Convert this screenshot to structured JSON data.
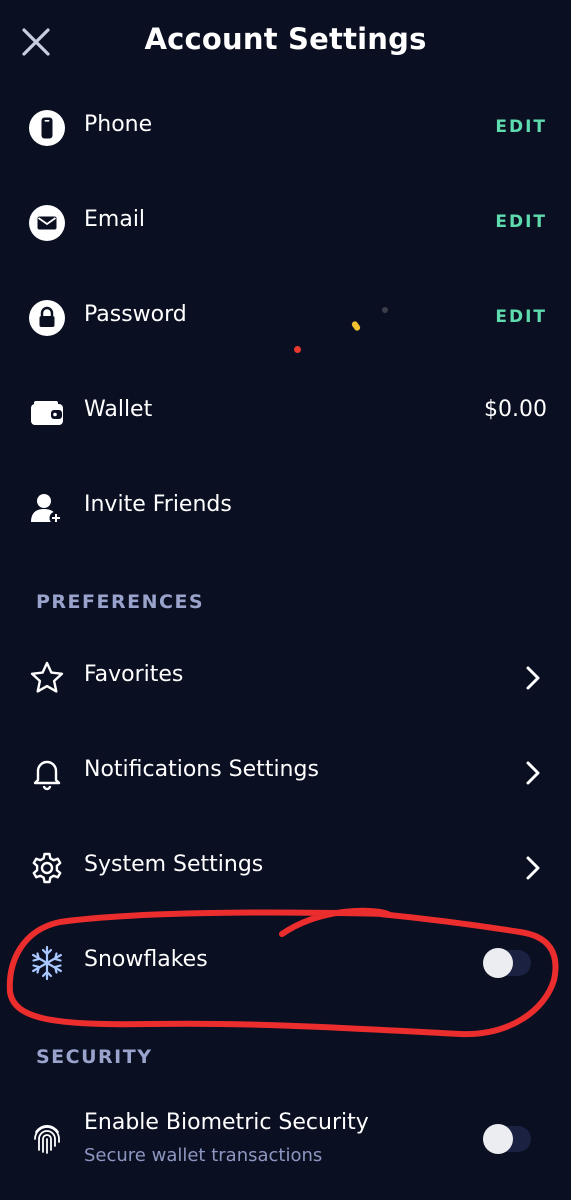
{
  "header": {
    "title": "Account Settings",
    "close_icon": "close-icon"
  },
  "account": {
    "phone": {
      "label": "Phone",
      "action": "EDIT",
      "icon": "phone-icon"
    },
    "email": {
      "label": "Email",
      "action": "EDIT",
      "icon": "envelope-icon"
    },
    "password": {
      "label": "Password",
      "action": "EDIT",
      "icon": "lock-icon"
    },
    "wallet": {
      "label": "Wallet",
      "value": "$0.00",
      "icon": "wallet-icon"
    },
    "invite": {
      "label": "Invite Friends",
      "icon": "add-user-icon"
    }
  },
  "preferences": {
    "header": "PREFERENCES",
    "items": [
      {
        "label": "Favorites",
        "icon": "star-icon"
      },
      {
        "label": "Notifications Settings",
        "icon": "bell-icon"
      },
      {
        "label": "System Settings",
        "icon": "gear-icon"
      }
    ],
    "snowflakes": {
      "label": "Snowflakes",
      "icon": "snowflake-icon",
      "enabled": false
    }
  },
  "security": {
    "header": "SECURITY",
    "biometric": {
      "label": "Enable Biometric Security",
      "sublabel": "Secure wallet transactions",
      "icon": "fingerprint-icon",
      "enabled": false
    }
  },
  "colors": {
    "background": "#0a0f22",
    "accent_edit": "#5fdcae",
    "section_header": "#9aa3cc",
    "annotation_red": "#ec2d2d"
  }
}
